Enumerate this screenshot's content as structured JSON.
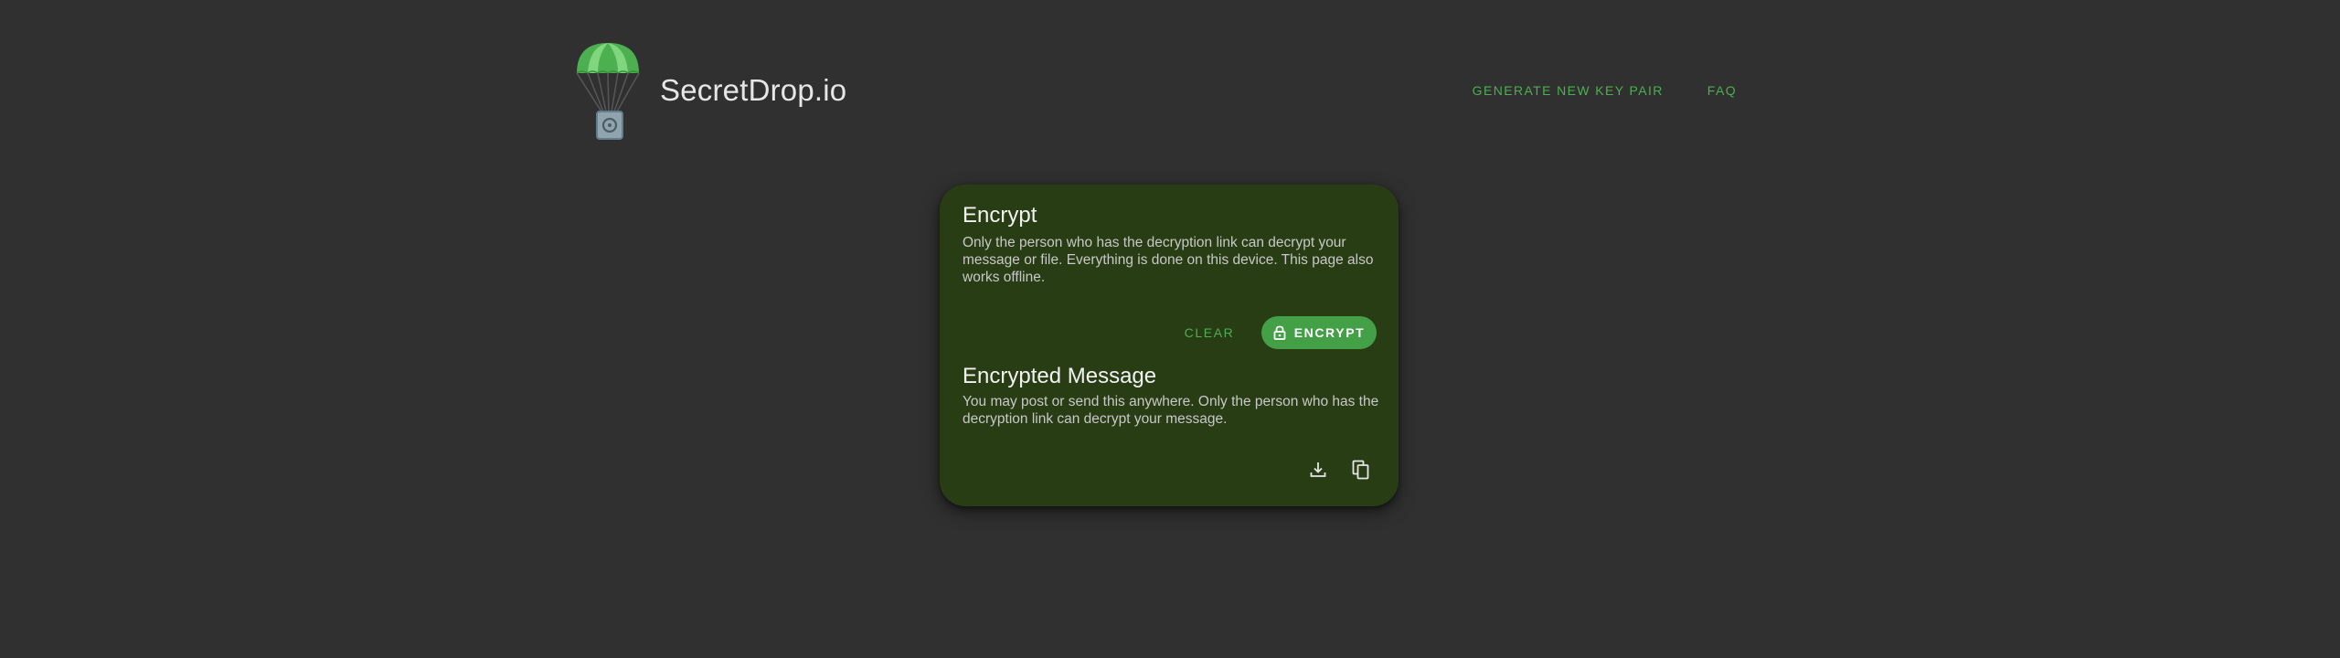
{
  "brand": {
    "name": "SecretDrop.io",
    "logo_icon": "parachute-safe-icon"
  },
  "nav": {
    "generate_key_pair": "Generate new key pair",
    "faq": "FAQ"
  },
  "encrypt_section": {
    "title": "Encrypt",
    "description": "Only the person who has the decryption link can decrypt your message or file. Everything is done on this device. This page also works offline.",
    "clear_label": "Clear",
    "encrypt_label": "Encrypt",
    "encrypt_icon": "lock-icon"
  },
  "encrypted_section": {
    "title": "Encrypted Message",
    "description": "You may post or send this anywhere. Only the person who has the decryption link can decrypt your message.",
    "download_icon": "download-icon",
    "copy_icon": "copy-icon"
  },
  "colors": {
    "background": "#303030",
    "card": "#293d15",
    "accent": "#4caf50",
    "button": "#43a047"
  }
}
